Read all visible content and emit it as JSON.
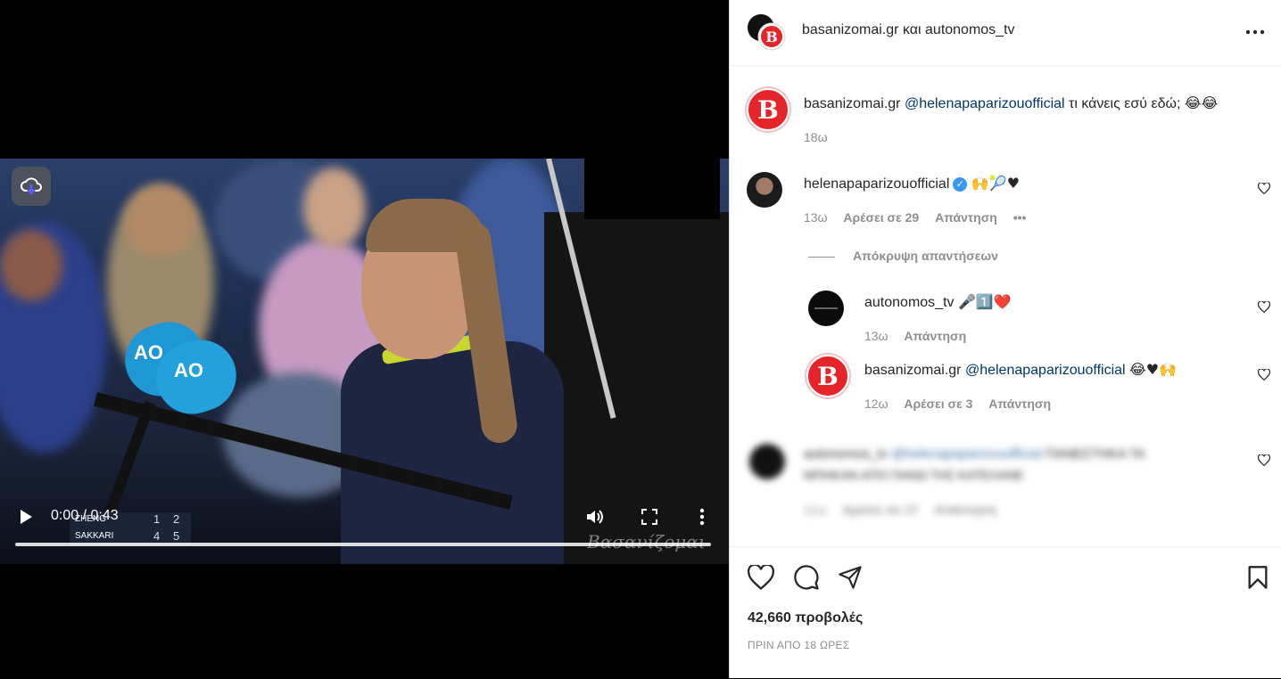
{
  "video": {
    "time": "0:00 / 0:43",
    "score_rows": [
      {
        "name": "ZHENG",
        "s1": "1",
        "s2": "2"
      },
      {
        "name": "SAKKARI",
        "s1": "4",
        "s2": "5"
      }
    ],
    "mic_logo": "AO",
    "watermark": "Βασανίζομαι"
  },
  "header": {
    "user1": "basanizomai.gr",
    "joiner": "και",
    "user2": "autonomos_tv"
  },
  "caption": {
    "user": "basanizomai.gr",
    "mention": "@helenapaparizouofficial",
    "text": "τι κάνεις εσύ εδώ;",
    "emoji": "😂😂",
    "time": "18ω"
  },
  "comments": [
    {
      "user": "helenapaparizouofficial",
      "verified": true,
      "emoji": "🙌🎾♥",
      "time": "13ω",
      "likes": "Αρέσει σε 29",
      "reply": "Απάντηση",
      "hide_replies": "Απόκρυψη απαντήσεων",
      "replies": [
        {
          "user": "autonomos_tv",
          "text": "🎤1️⃣❤️",
          "time": "13ω",
          "reply": "Απάντηση"
        },
        {
          "user": "basanizomai.gr",
          "mention": "@helenapaparizouofficial",
          "text": "😂♥🙌",
          "time": "12ω",
          "likes": "Αρέσει σε 3",
          "reply": "Απάντηση"
        }
      ]
    },
    {
      "user": "autonomos_tv",
      "mention": "@helenapaparizouofficial",
      "text": "ΠΑΝΕΣΤΗΚΑ ΤΑ",
      "text2": "ΜΠΗΚΑΝ ΑΠΟ ΠΑΝΩ ΤΗΣ ΚΑΤΕΛΑΝΕ",
      "time": "11ω",
      "likes": "Αρέσει σε 17",
      "reply": "Απάντηση"
    }
  ],
  "footer": {
    "views": "42,660 προβολές",
    "ago": "ΠΡΙΝ ΑΠΟ 18 ΩΡΕΣ"
  },
  "colors": {
    "brand_red": "#e5252a",
    "mention_blue": "#00376b",
    "muted_gray": "#8e8e8e",
    "verified_blue": "#3897f0"
  }
}
